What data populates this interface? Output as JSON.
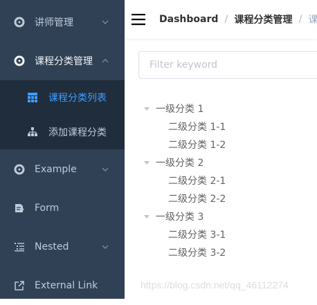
{
  "sidebar": {
    "items": [
      {
        "label": "讲师管理",
        "icon": "example-icon"
      },
      {
        "label": "课程分类管理",
        "icon": "example-icon"
      },
      {
        "label": "Example",
        "icon": "example-icon"
      },
      {
        "label": "Form",
        "icon": "form-icon"
      },
      {
        "label": "Nested",
        "icon": "nested-icon"
      },
      {
        "label": "External Link",
        "icon": "link-icon"
      }
    ],
    "submenu": [
      {
        "label": "课程分类列表",
        "icon": "table-icon",
        "active": true
      },
      {
        "label": "添加课程分类",
        "icon": "tree-icon",
        "active": false
      }
    ],
    "colors": {
      "bg": "#304156",
      "submenu_bg": "#1f2d3d",
      "text": "#bfcbd9",
      "active": "#409eff"
    }
  },
  "navbar": {
    "breadcrumb": [
      "Dashboard",
      "课程分类管理",
      "课程"
    ],
    "separator": "/"
  },
  "filter": {
    "placeholder": "Filter keyword",
    "value": ""
  },
  "tree": [
    {
      "label": "一级分类 1",
      "children": [
        "二级分类 1-1",
        "二级分类 1-2"
      ]
    },
    {
      "label": "一级分类 2",
      "children": [
        "二级分类 2-1",
        "二级分类 2-2"
      ]
    },
    {
      "label": "一级分类 3",
      "children": [
        "二级分类 3-1",
        "二级分类 3-2"
      ]
    }
  ],
  "watermark": "https://blog.csdn.net/qq_46112274"
}
